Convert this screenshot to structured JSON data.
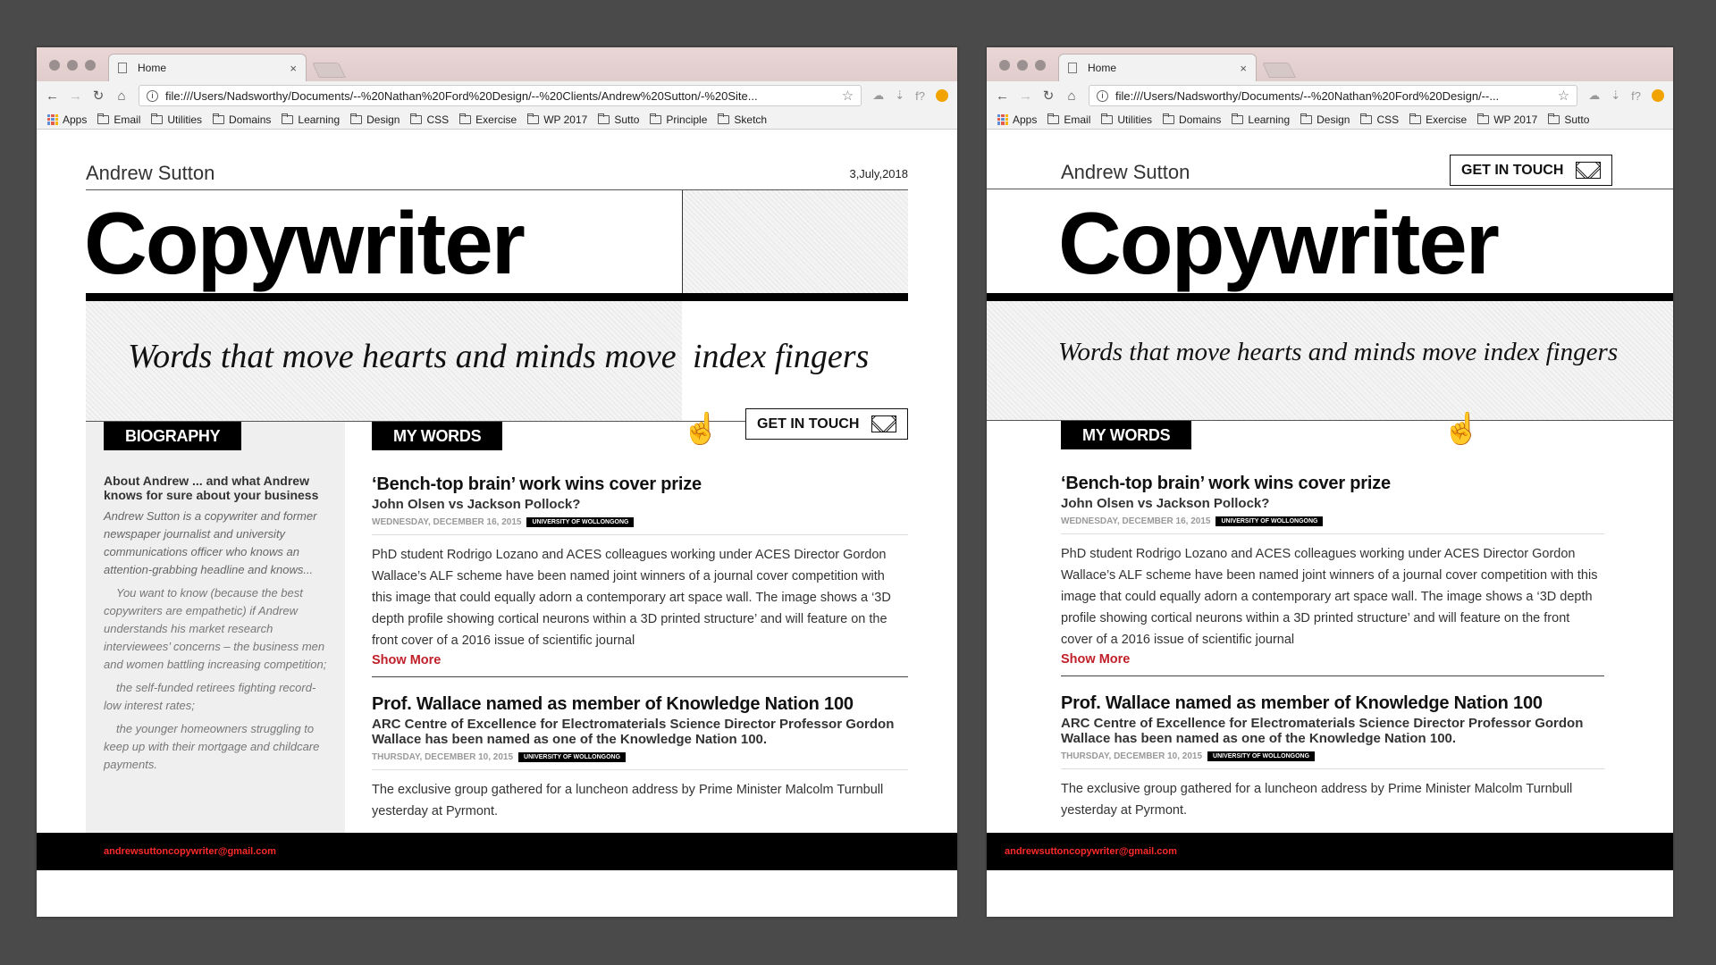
{
  "browser": {
    "tab_title": "Home",
    "tab_close": "×",
    "url_left": "file:///Users/Nadsworthy/Documents/--%20Nathan%20Ford%20Design/--%20Clients/Andrew%20Sutton/-%20Site...",
    "url_right": "file:///Users/Nadsworthy/Documents/--%20Nathan%20Ford%20Design/--...",
    "bookmarks_left": [
      "Email",
      "Utilities",
      "Domains",
      "Learning",
      "Design",
      "CSS",
      "Exercise",
      "WP 2017",
      "Sutto",
      "Principle",
      "Sketch"
    ],
    "bookmarks_right": [
      "Email",
      "Utilities",
      "Domains",
      "Learning",
      "Design",
      "CSS",
      "Exercise",
      "WP 2017",
      "Sutto"
    ],
    "apps_label": "Apps",
    "ext_label": "f?"
  },
  "site": {
    "name": "Andrew Sutton",
    "date": "3,July,2018",
    "title": "Copywriter",
    "tagline_left": "Words that move hearts and minds move",
    "tagline_right": "index fingers",
    "tagline_full": "Words that move hearts and minds move index fingers",
    "get_in_touch": "GET IN TOUCH",
    "footer_email": "andrewsuttoncopywriter@gmail.com"
  },
  "biography": {
    "label": "BIOGRAPHY",
    "heading": "About Andrew ... and what Andrew knows for sure about your business",
    "intro": "Andrew Sutton is a copywriter and former newspaper journalist and university communications officer who knows an attention-grabbing headline and knows...",
    "p1": "You want to know (because the best copywriters are empathetic) if Andrew understands his market research interviewees’ concerns – the business men and women battling increasing competition;",
    "p2": "the self-funded retirees fighting record-low interest rates;",
    "p3": "the younger homeowners struggling to keep up with their mortgage and childcare payments."
  },
  "my_words": {
    "label": "MY WORDS",
    "articles": [
      {
        "title": "‘Bench-top brain’ work wins cover prize",
        "subtitle": "John Olsen vs Jackson Pollock?",
        "date": "WEDNESDAY, DECEMBER 16, 2015",
        "badge": "UNIVERSITY OF WOLLONGONG",
        "body": "PhD student Rodrigo Lozano and ACES colleagues working under ACES Director Gordon Wallace’s ALF scheme have been named joint winners of a journal cover competition with this image that could equally adorn a contemporary art space wall. The image shows a ‘3D depth profile showing cortical neurons within a 3D printed structure’ and will feature on the front cover of a 2016 issue of scientific journal",
        "more": "Show More"
      },
      {
        "title": "Prof. Wallace named as member of Knowledge Nation 100",
        "subtitle": "ARC Centre of Excellence for Electromaterials Science Director Professor Gordon Wallace has been named as one of the Knowledge Nation 100.",
        "date": "THURSDAY, DECEMBER 10, 2015",
        "badge": "UNIVERSITY OF WOLLONGONG",
        "body": "The exclusive group gathered for a luncheon address by Prime Minister Malcolm Turnbull yesterday at Pyrmont."
      }
    ]
  }
}
